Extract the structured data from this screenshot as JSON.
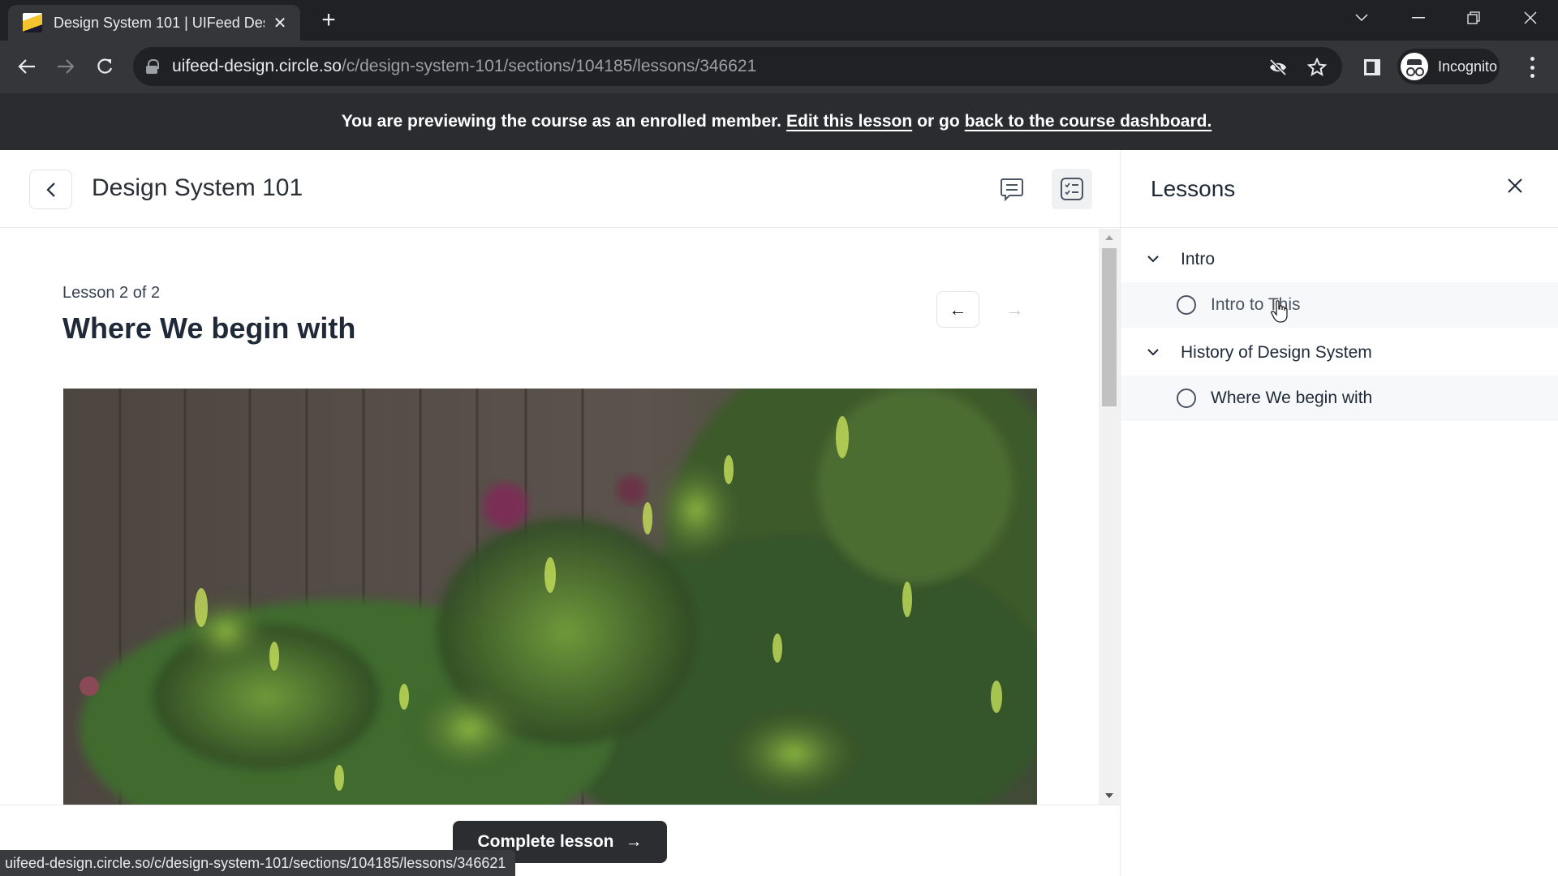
{
  "browser": {
    "tab_title": "Design System 101 | UIFeed Desi",
    "url_host": "uifeed-design.circle.so",
    "url_path": "/c/design-system-101/sections/104185/lessons/346621",
    "profile_label": "Incognito",
    "status_url": "uifeed-design.circle.so/c/design-system-101/sections/104185/lessons/346621",
    "icons": {
      "tab_close": "close-icon",
      "new_tab": "plus-icon",
      "back": "arrow-left-icon",
      "forward": "arrow-right-icon",
      "reload": "reload-icon",
      "tracking": "eye-off-icon",
      "bookmark": "star-icon",
      "side_panel": "side-panel-icon",
      "menu": "kebab-menu-icon"
    }
  },
  "banner": {
    "text_before": "You are previewing the course as an enrolled member.",
    "edit_link": "Edit this lesson",
    "text_middle": "or go",
    "dashboard_link": "back to the course dashboard."
  },
  "header": {
    "course_title": "Design System 101",
    "icons": [
      "comment-icon",
      "checklist-icon"
    ]
  },
  "lesson": {
    "counter": "Lesson 2 of 2",
    "title": "Where We begin with",
    "prev_arrow": "←",
    "next_arrow": "→"
  },
  "footer": {
    "complete_label": "Complete lesson",
    "complete_arrow": "→"
  },
  "sidebar": {
    "title": "Lessons",
    "sections": [
      {
        "label": "Intro",
        "lessons": [
          {
            "label": "Intro to This",
            "completed": false
          }
        ]
      },
      {
        "label": "History of Design System",
        "lessons": [
          {
            "label": "Where We begin with",
            "completed": false
          }
        ]
      }
    ]
  },
  "colors": {
    "banner_bg": "#2a2c30",
    "button_dark": "#2b2d31",
    "lesson_item_bg": "#f7f8fa",
    "text_primary": "#1f2937"
  }
}
